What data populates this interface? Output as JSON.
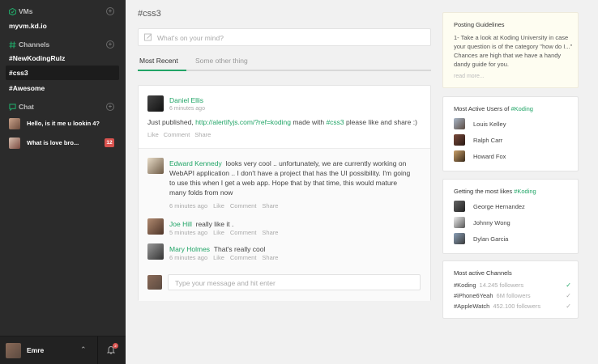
{
  "sidebar": {
    "vms": {
      "header": "VMs",
      "items": [
        {
          "label": "myvm.kd.io"
        }
      ]
    },
    "channels": {
      "header": "Channels",
      "items": [
        {
          "label": "#NewKodingRulz"
        },
        {
          "label": "#css3"
        },
        {
          "label": "#Awesome"
        }
      ]
    },
    "chat": {
      "header": "Chat",
      "items": [
        {
          "label": "Hello, is it me u lookin 4?",
          "badge": ""
        },
        {
          "label": "What is love bro...",
          "badge": "12"
        }
      ]
    },
    "user": {
      "name": "Emre",
      "notifications": "2"
    }
  },
  "main": {
    "title": "#css3",
    "composer_placeholder": "What's on your mind?",
    "tabs": [
      {
        "label": "Most Recent"
      },
      {
        "label": "Some other thing"
      }
    ],
    "post": {
      "author": "Daniel Ellis",
      "timestamp": "6 minutes ago",
      "body_prefix": "Just published, ",
      "body_link": "http://alertifyjs.com/?ref=koding",
      "body_middle": " made with ",
      "body_tag": "#css3",
      "body_suffix": " please like and share :)",
      "actions": {
        "like": "Like",
        "comment": "Comment",
        "share": "Share"
      },
      "comments": [
        {
          "author": "Edward Kennedy",
          "text": "looks very cool .. unfortunately, we are currently working on WebAPI application .. I don't have a project that has the UI possibility. I'm going to use this when I get a web app. Hope that by that time, this would mature many folds from now",
          "timestamp": "6 minutes ago",
          "like": "Like",
          "comment": "Comment",
          "share": "Share"
        },
        {
          "author": "Joe Hill",
          "text": "really like it .",
          "timestamp": "5 minutes ago",
          "like": "Like",
          "comment": "Comment",
          "share": "Share"
        },
        {
          "author": "Mary Holmes",
          "text": "That's really cool",
          "timestamp": "6 minutes ago",
          "like": "Like",
          "comment": "Comment",
          "share": "Share"
        }
      ],
      "reply_placeholder": "Type your message and hit enter"
    }
  },
  "right": {
    "guidelines": {
      "title": "Posting Guidelines",
      "text": "1- Take a look at Koding University in case your question is of the category \"how do I...\" Chances are high that we have a handy dandy guide for you.",
      "read_more": "read more..."
    },
    "active_users": {
      "title_prefix": "Most Active Users of ",
      "title_tag": "#Koding",
      "users": [
        {
          "name": "Louis Kelley"
        },
        {
          "name": "Ralph Carr"
        },
        {
          "name": "Howard Fox"
        }
      ]
    },
    "most_likes": {
      "title_prefix": "Getting the most likes ",
      "title_tag": "#Koding",
      "users": [
        {
          "name": "George Hernandez"
        },
        {
          "name": "Johnny Wong"
        },
        {
          "name": "Dylan Garcia"
        }
      ]
    },
    "active_channels": {
      "title": "Most active Channels",
      "channels": [
        {
          "name": "#Koding",
          "followers": "14.245 followers",
          "check_color": "#21a567"
        },
        {
          "name": "#iPhone6Yeah",
          "followers": "6M followers",
          "check_color": "#aaaaaa"
        },
        {
          "name": "#AppleWatch",
          "followers": "452.100 followers",
          "check_color": "#aaaaaa"
        }
      ]
    }
  },
  "colors": {
    "accent": "#21a567",
    "sidebar_bg": "#2b2b2b",
    "badge": "#d9534f"
  },
  "icons": [
    "vm-icon",
    "hash-icon",
    "chat-bubble-icon",
    "add-icon",
    "pencil-icon",
    "bell-icon",
    "chevron-up-icon",
    "check-icon"
  ]
}
